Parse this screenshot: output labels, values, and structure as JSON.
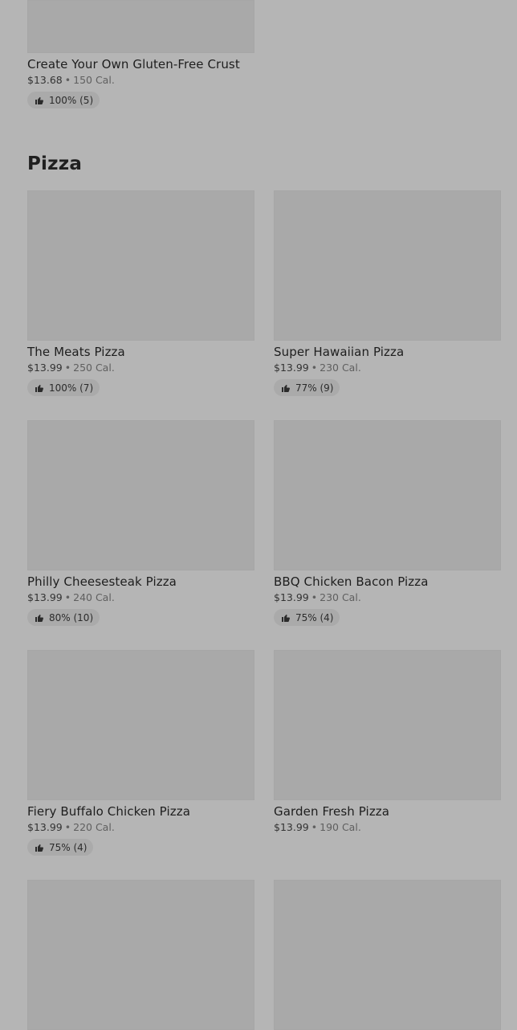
{
  "top_item": {
    "name": "Create Your Own Gluten-Free Crust",
    "price": "$13.68",
    "calories": "150 Cal.",
    "rating": "100% (5)"
  },
  "section": {
    "title": "Pizza"
  },
  "items": [
    {
      "name": "The Meats Pizza",
      "price": "$13.99",
      "calories": "250 Cal.",
      "rating": "100% (7)"
    },
    {
      "name": "Super Hawaiian Pizza",
      "price": "$13.99",
      "calories": "230 Cal.",
      "rating": "77% (9)"
    },
    {
      "name": "Philly Cheesesteak Pizza",
      "price": "$13.99",
      "calories": "240 Cal.",
      "rating": "80% (10)"
    },
    {
      "name": "BBQ Chicken Bacon Pizza",
      "price": "$13.99",
      "calories": "230 Cal.",
      "rating": "75% (4)"
    },
    {
      "name": "Fiery Buffalo Chicken Pizza",
      "price": "$13.99",
      "calories": "220 Cal.",
      "rating": "75% (4)"
    },
    {
      "name": "Garden Fresh Pizza",
      "price": "$13.99",
      "calories": "190 Cal.",
      "rating": null
    }
  ],
  "separator": "•",
  "icons": {
    "thumbs_up": "thumbs-up-icon"
  },
  "colors": {
    "overlay_background": "#b5b5b5",
    "image_placeholder": "#a9a9a9",
    "rating_pill": "#aaaaaa"
  }
}
